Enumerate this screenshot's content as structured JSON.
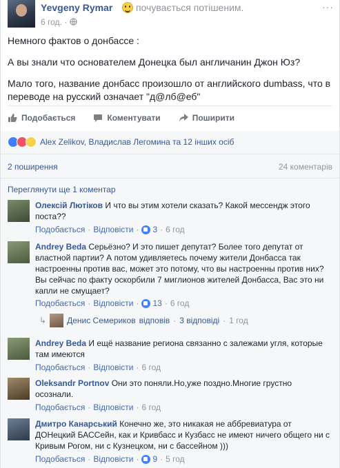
{
  "post": {
    "author": "Yevgeny Rymar",
    "feeling": "почувається потішеним.",
    "time": "6 год.",
    "time_sep": "·",
    "menu": "···",
    "paragraphs": [
      "Немного фактов о донбассе :",
      "А вы знали что основателем Донецка был англичанин Джон Юз?",
      "Мало того, название донбасс произошло от английского dumbass, что в переводе на русский означает \"д@лб@еб\""
    ]
  },
  "actions": {
    "like": "Подобається",
    "comment": "Коментувати",
    "share": "Поширити"
  },
  "summary": {
    "reactions_text": "Alex Zelikov, Владислав Легомина та 12 інших осіб",
    "shares": "2 поширення",
    "comments": "24 коментарів",
    "view_more": "Переглянути ще 1 коментар"
  },
  "comments": [
    {
      "name": "Олексій Лютіков",
      "text": "И что вы этим хотели сказать? Какой мессендж этого поста??",
      "like": "Подобається",
      "reply": "Відповісти",
      "likes": "3",
      "time": "6 год"
    },
    {
      "name": "Andrey Beda",
      "text": "Серьёзно? И это пишет депутат? Более того депутат от властной партии? А потом удивляетесь почему жители Донбасса так настроенны против вас, может это потому, что вы настроенны против них? Вы сейчас по факту оскорбили 7 миглионов жителей Донбасса, Вас это ни капли не смущает?",
      "like": "Подобається",
      "reply": "Відповісти",
      "likes": "13",
      "time": "6 год"
    },
    {
      "name": "Andrey Beda",
      "text": "И ещё название региона связанно с залежами угля, которые там имеются",
      "like": "Подобається",
      "reply": "Відповісти",
      "likes": "",
      "time": "6 год"
    },
    {
      "name": "Oleksandr Portnov",
      "text": "Они это поняли.Но,уже поздно.Многие грустно осознали.",
      "like": "Подобається",
      "reply": "Відповісти",
      "likes": "",
      "time": "6 год"
    },
    {
      "name": "Дмитро Канарський",
      "text": "Конечно же, это никакая не аббревиатура от ДОНецкий БАССейн, как и Кривбасс и Кузбасс не имеют ничего общего ни с Кривым Рогом, ни с Кузнецком, ни с бассейном )))",
      "like": "Подобається",
      "reply": "Відповісти",
      "likes": "9",
      "time": "5 год"
    }
  ],
  "reply_thread": {
    "name": "Денис Семериков",
    "action": "відповів",
    "count": "3 відповіді",
    "time": "1 год"
  },
  "dot": "·"
}
